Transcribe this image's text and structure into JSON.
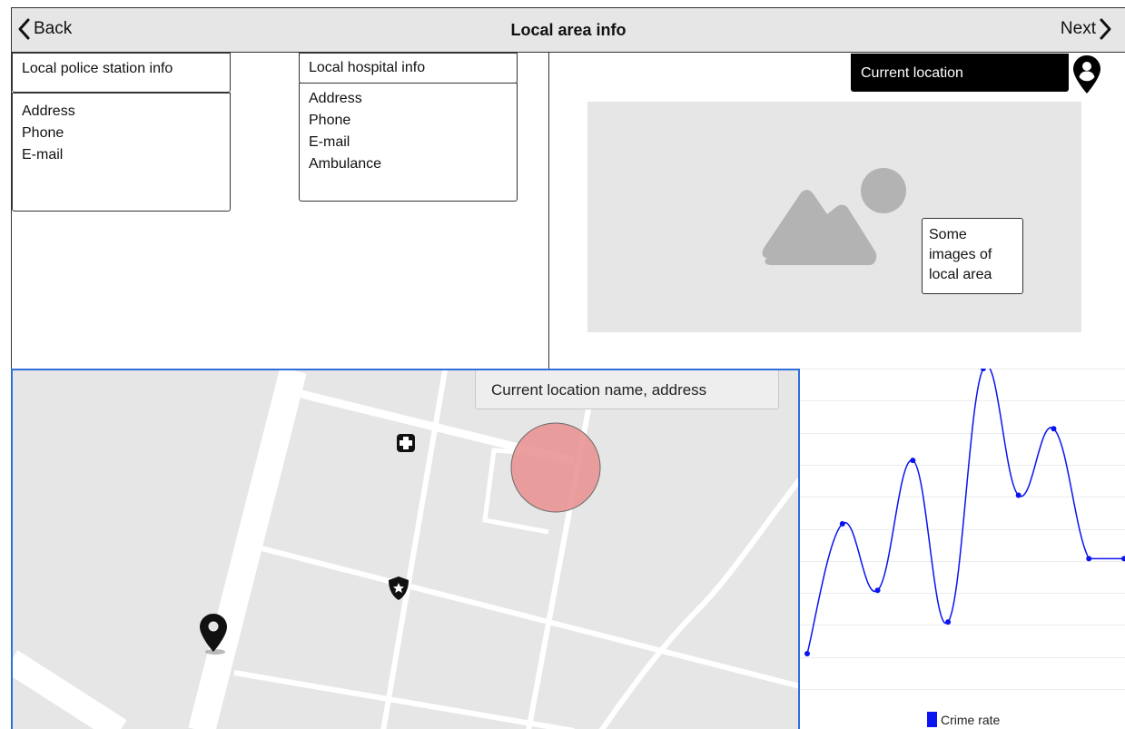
{
  "header": {
    "back_label": "Back",
    "title": "Local area info",
    "next_label": "Next"
  },
  "police": {
    "title": "Local police station info",
    "fields": [
      "Address",
      "Phone",
      "E-mail"
    ]
  },
  "hospital": {
    "title": "Local hospital info",
    "fields": [
      "Address",
      "Phone",
      "E-mail",
      "Ambulance"
    ]
  },
  "location": {
    "button_label": "Current location",
    "icon": "user-location-pin-icon"
  },
  "images": {
    "note": "Some images of local area",
    "icon": "image-placeholder-icon"
  },
  "map": {
    "label": "Current location name, address",
    "icons": [
      "hospital-icon",
      "police-icon",
      "map-pin-icon"
    ],
    "highlight_color": "#e88e8e"
  },
  "chart_data": {
    "type": "line",
    "series": [
      {
        "name": "Crime rate",
        "color": "#0a14f0",
        "values": [
          0,
          4.1,
          2.0,
          6.1,
          1.0,
          9.0,
          5.0,
          7.1,
          3.0,
          3.0
        ]
      }
    ],
    "grid": true,
    "legend_position": "bottom"
  }
}
